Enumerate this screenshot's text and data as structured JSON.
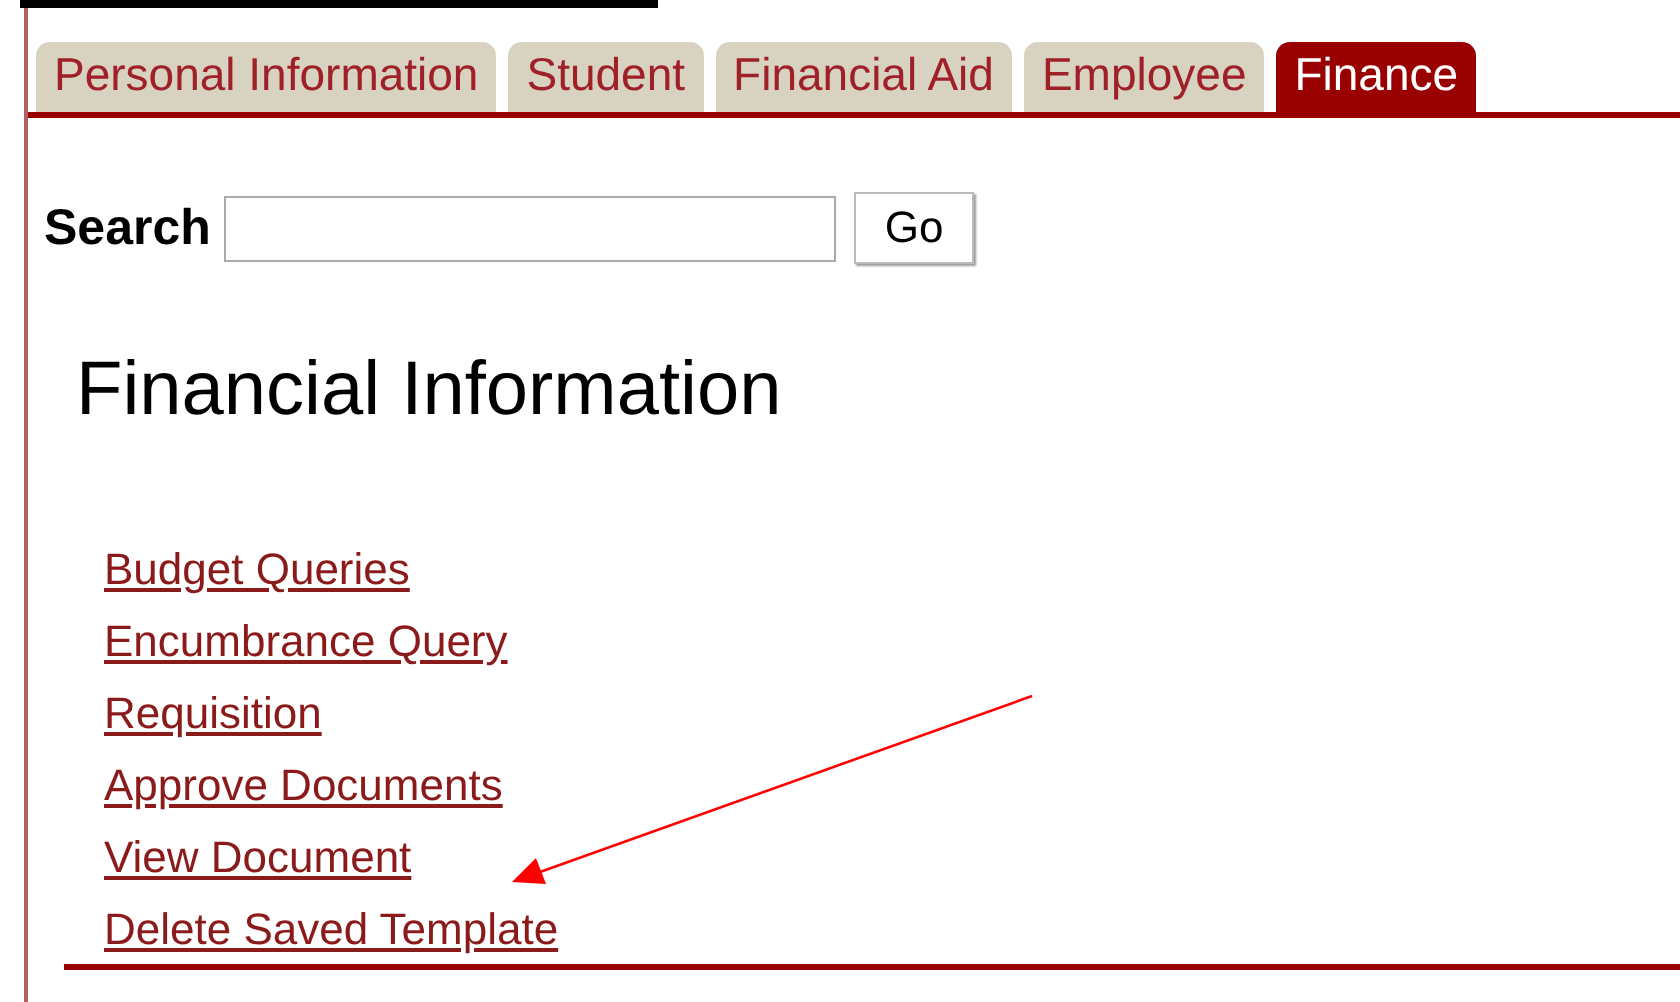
{
  "tabs": [
    {
      "label": "Personal Information",
      "selected": false
    },
    {
      "label": "Student",
      "selected": false
    },
    {
      "label": "Financial Aid",
      "selected": false
    },
    {
      "label": "Employee",
      "selected": false
    },
    {
      "label": "Finance",
      "selected": true
    }
  ],
  "search": {
    "label": "Search",
    "button": "Go"
  },
  "heading": "Financial Information",
  "links": [
    "Budget Queries",
    "Encumbrance Query",
    "Requisition",
    "Approve Documents",
    "View Document",
    "Delete Saved Template"
  ]
}
